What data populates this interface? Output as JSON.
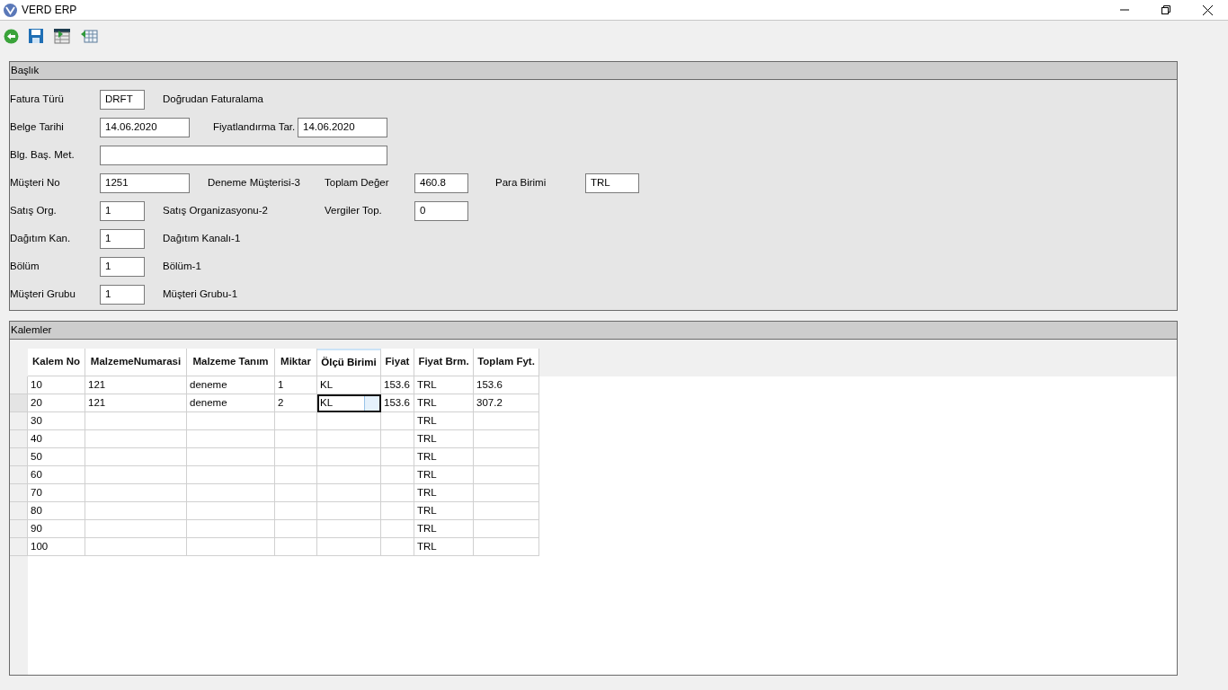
{
  "window": {
    "title": "VERD ERP"
  },
  "header_section": {
    "title": "Başlık",
    "rows": [
      [
        {
          "kind": "label",
          "text": "Fatura Türü"
        },
        {
          "kind": "field",
          "value": "DRFT"
        },
        {
          "kind": "text",
          "text": "Doğrudan Faturalama"
        }
      ],
      [
        {
          "kind": "label",
          "text": "Belge Tarihi"
        },
        {
          "kind": "field",
          "value": "14.06.2020"
        },
        {
          "kind": "label",
          "text": "Fiyatlandırma Tar."
        },
        {
          "kind": "field",
          "value": "14.06.2020"
        }
      ],
      [
        {
          "kind": "label",
          "text": "Blg. Baş. Met."
        },
        {
          "kind": "field"
        }
      ],
      [
        {
          "kind": "label",
          "text": "Müşteri No"
        },
        {
          "kind": "field",
          "value": "1251"
        },
        {
          "kind": "text",
          "text": "Deneme Müşterisi-3"
        },
        {
          "kind": "label",
          "text": "Toplam Değer"
        },
        {
          "kind": "field",
          "value": "460.8"
        },
        {
          "kind": "label",
          "text": "Para Birimi"
        },
        {
          "kind": "field",
          "value": "TRL"
        }
      ],
      [
        {
          "kind": "label",
          "text": "Satış Org."
        },
        {
          "kind": "field",
          "value": "1"
        },
        {
          "kind": "text",
          "text": "Satış Organizasyonu-2"
        },
        {
          "kind": "label",
          "text": "Vergiler Top."
        },
        {
          "kind": "field",
          "value": "0"
        }
      ],
      [
        {
          "kind": "label",
          "text": "Dağıtım Kan."
        },
        {
          "kind": "field",
          "value": "1"
        },
        {
          "kind": "text",
          "text": "Dağıtım Kanalı-1"
        }
      ],
      [
        {
          "kind": "label",
          "text": "Bölüm"
        },
        {
          "kind": "field",
          "value": "1"
        },
        {
          "kind": "text",
          "text": "Bölüm-1"
        }
      ],
      [
        {
          "kind": "label",
          "text": "Müşteri Grubu"
        },
        {
          "kind": "field",
          "value": "1"
        },
        {
          "kind": "text",
          "text": "Müşteri Grubu-1"
        }
      ]
    ]
  },
  "items_section": {
    "title": "Kalemler",
    "table": {
      "columns": [
        {
          "label": "Kalem No",
          "selected": false
        },
        {
          "label": "MalzemeNumarasi",
          "selected": false
        },
        {
          "label": "Malzeme Tanım",
          "selected": false
        },
        {
          "label": "Miktar",
          "selected": false
        },
        {
          "label": "Ölçü Birimi",
          "selected": true
        },
        {
          "label": "Fiyat",
          "selected": false
        },
        {
          "label": "Fiyat Brm.",
          "selected": false
        },
        {
          "label": "Toplam Fyt.",
          "selected": false
        }
      ],
      "rows": [
        {
          "selected": false,
          "cells": [
            "10",
            "121",
            "deneme",
            "1",
            "KL",
            "153.6",
            "TRL",
            "153.6"
          ]
        },
        {
          "selected": true,
          "cells": [
            "20",
            "121",
            "deneme",
            "2",
            "KL",
            "153.6",
            "TRL",
            "307.2"
          ]
        },
        {
          "selected": false,
          "cells": [
            "30",
            null,
            null,
            null,
            null,
            null,
            "TRL",
            null
          ]
        },
        {
          "selected": false,
          "cells": [
            "40",
            null,
            null,
            null,
            null,
            null,
            "TRL",
            null
          ]
        },
        {
          "selected": false,
          "cells": [
            "50",
            null,
            null,
            null,
            null,
            null,
            "TRL",
            null
          ]
        },
        {
          "selected": false,
          "cells": [
            "60",
            null,
            null,
            null,
            null,
            null,
            "TRL",
            null
          ]
        },
        {
          "selected": false,
          "cells": [
            "70",
            null,
            null,
            null,
            null,
            null,
            "TRL",
            null
          ]
        },
        {
          "selected": false,
          "cells": [
            "80",
            null,
            null,
            null,
            null,
            null,
            "TRL",
            null
          ]
        },
        {
          "selected": false,
          "cells": [
            "90",
            null,
            null,
            null,
            null,
            null,
            "TRL",
            null
          ]
        },
        {
          "selected": false,
          "cells": [
            "100",
            null,
            null,
            null,
            null,
            null,
            "TRL",
            null
          ]
        }
      ]
    }
  }
}
